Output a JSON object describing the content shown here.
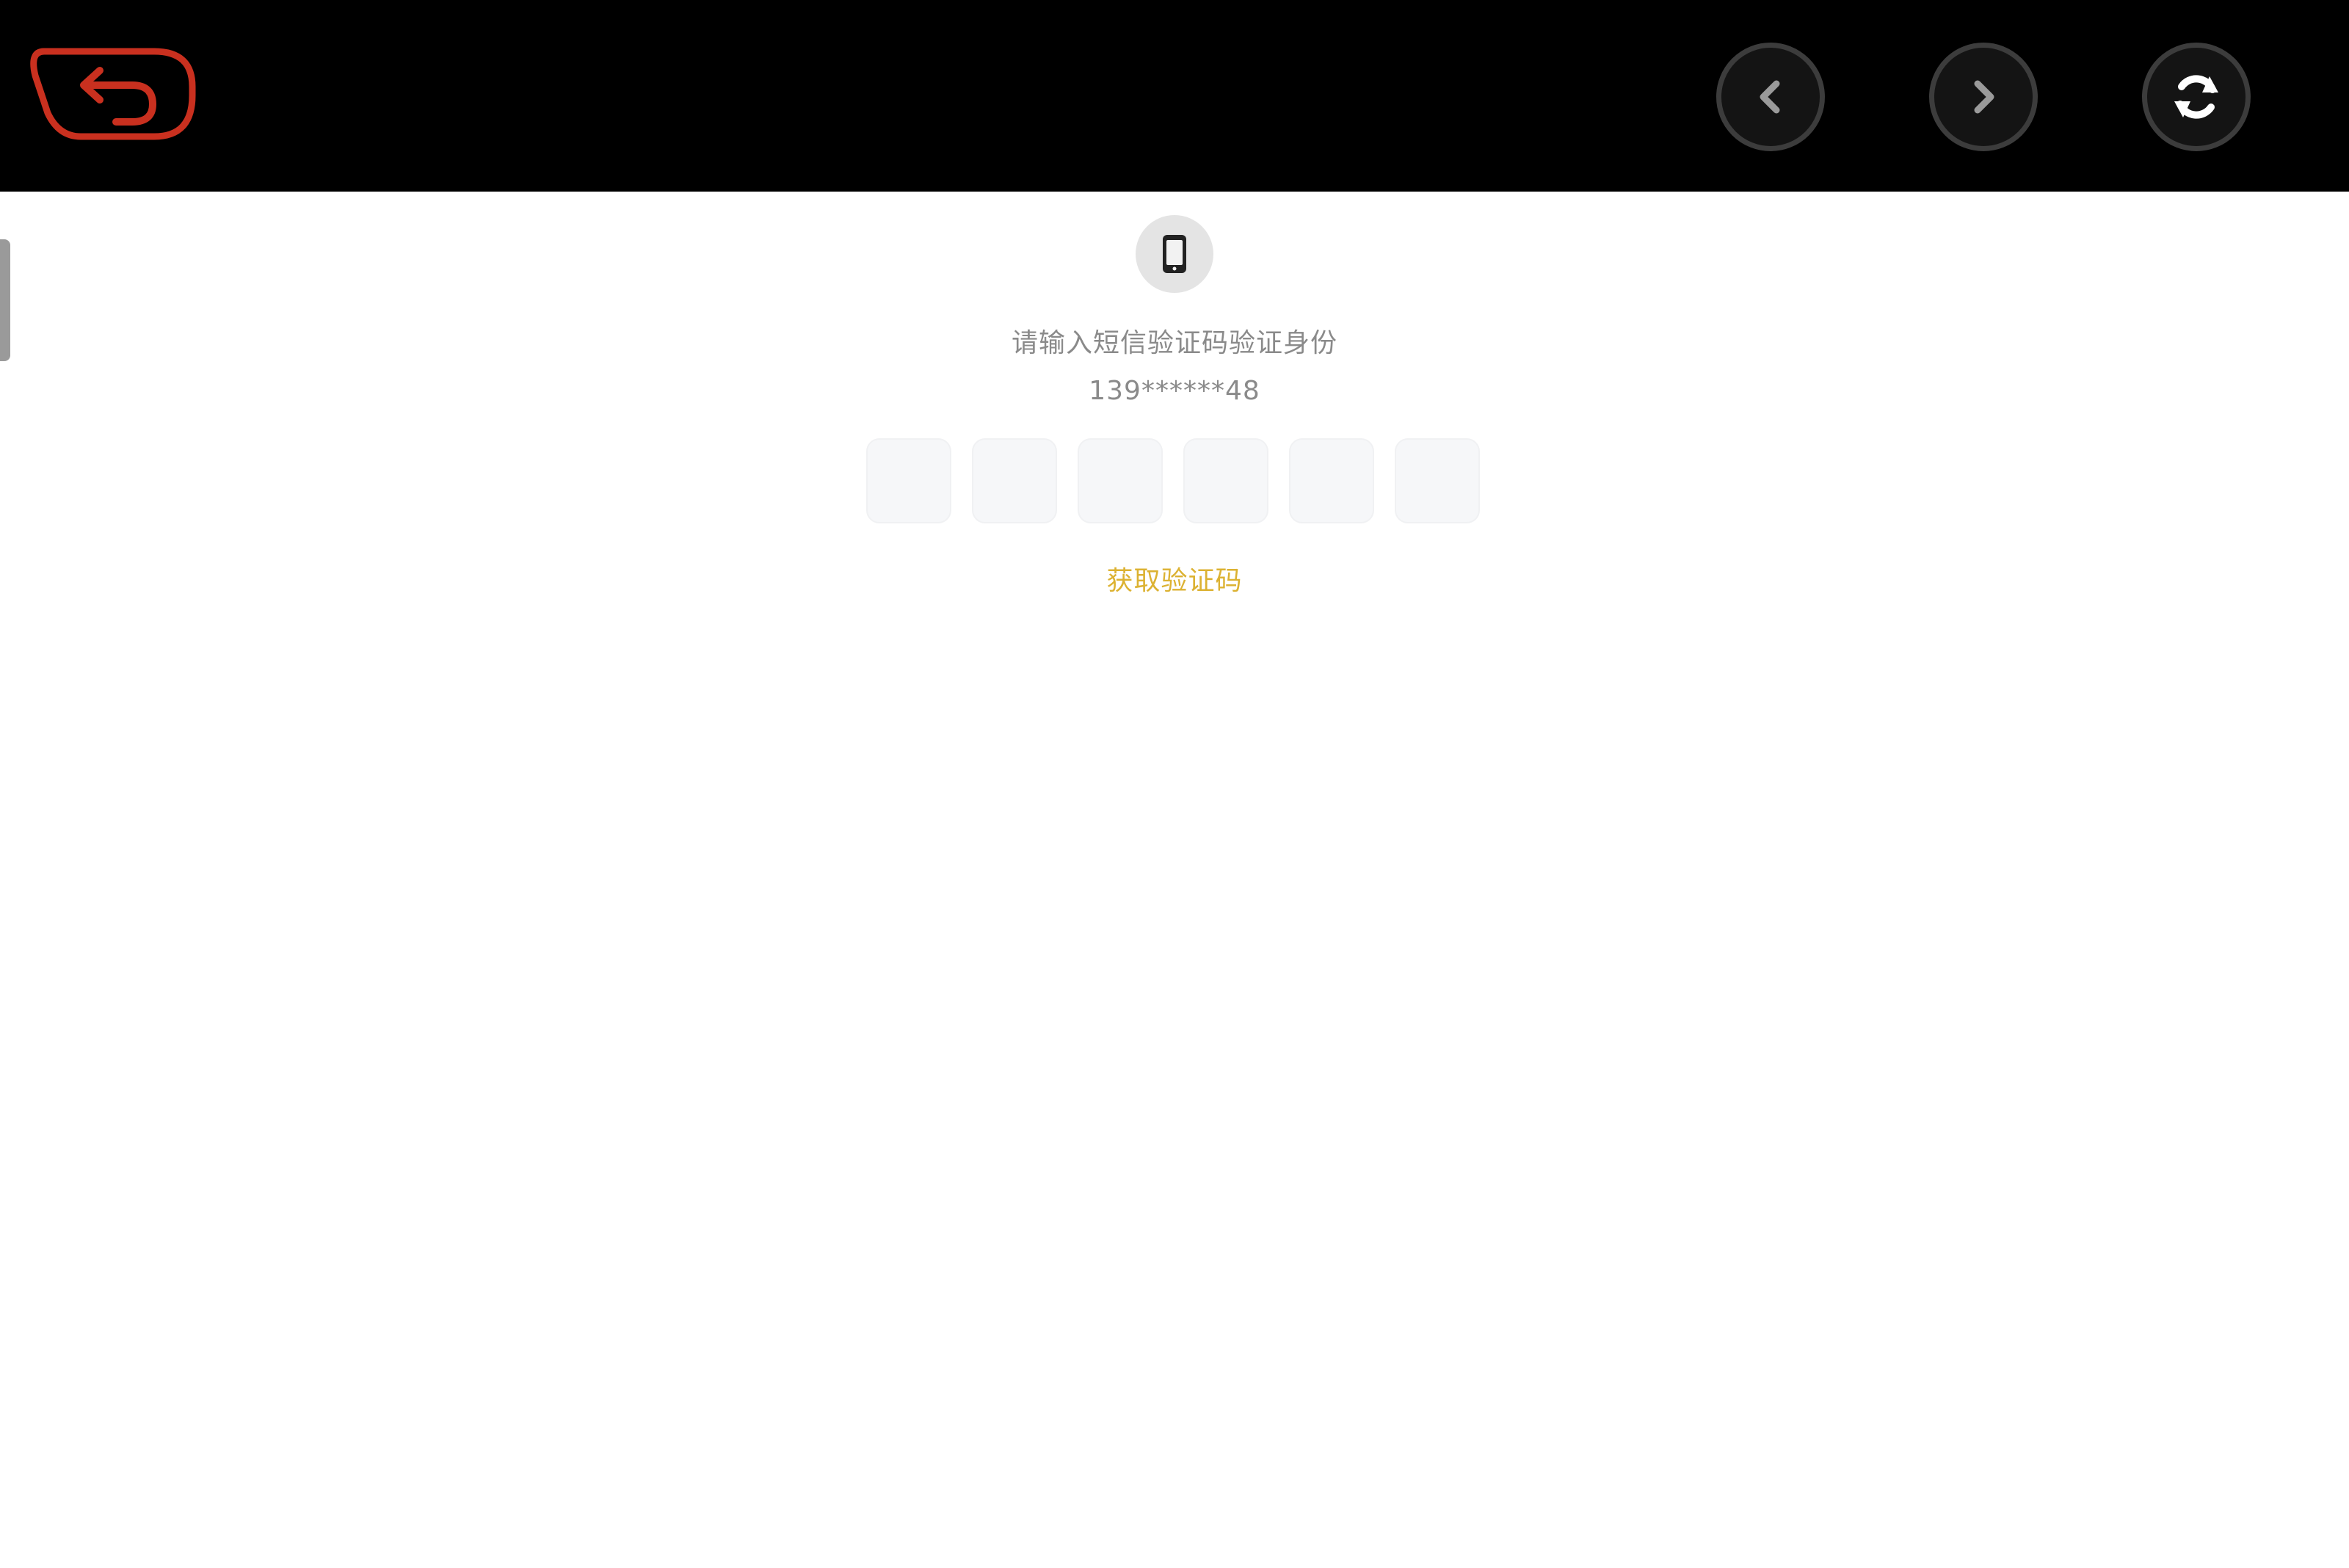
{
  "header": {
    "back_icon": "back-arrow-icon",
    "prev_icon": "chevron-left-icon",
    "next_icon": "chevron-right-icon",
    "refresh_icon": "refresh-icon",
    "back_color": "#c9301f"
  },
  "verification": {
    "icon": "mobile-phone-icon",
    "prompt": "请输入短信验证码验证身份",
    "phone_number": "139******48",
    "code_digits": [
      "",
      "",
      "",
      "",
      "",
      ""
    ],
    "get_code_label": "获取验证码",
    "accent_color": "#dcb232"
  }
}
